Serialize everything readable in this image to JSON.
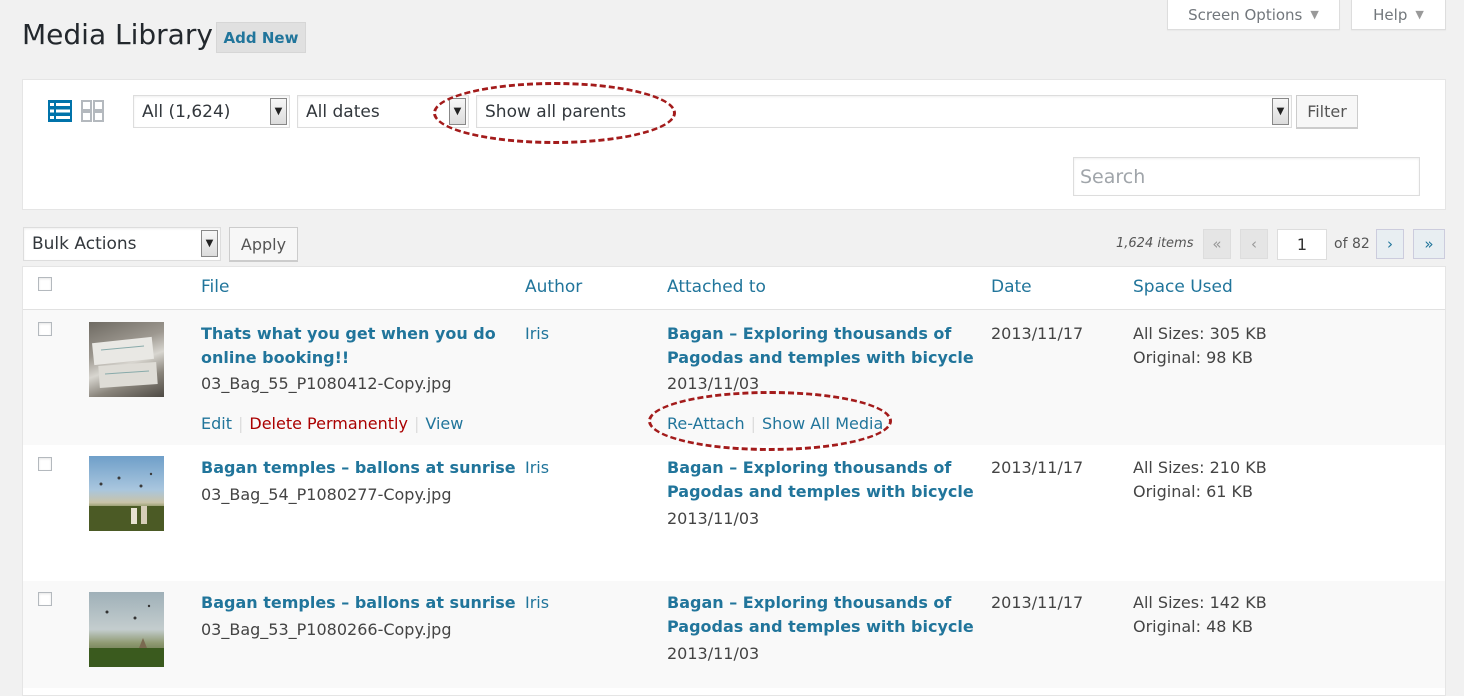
{
  "header": {
    "title": "Media Library",
    "add_new": "Add New",
    "screen_options": "Screen Options",
    "help": "Help"
  },
  "filters": {
    "type_select": "All (1,624)",
    "date_select": "All dates",
    "parent_select": "Show all parents",
    "filter_button": "Filter",
    "search_placeholder": "Search"
  },
  "bulk": {
    "select": "Bulk Actions",
    "apply": "Apply"
  },
  "pagination": {
    "items": "1,624 items",
    "first": "«",
    "prev": "‹",
    "current": "1",
    "of_total": "of 82",
    "next": "›",
    "last": "»"
  },
  "columns": {
    "file": "File",
    "author": "Author",
    "attached_to": "Attached to",
    "date": "Date",
    "space_used": "Space Used"
  },
  "rows": [
    {
      "title_line1": "Thats what you get when you do",
      "title_line2": "online booking!!",
      "filename": "03_Bag_55_P1080412-Copy.jpg",
      "author": "Iris",
      "attached_line1": "Bagan – Exploring thousands of",
      "attached_line2": "Pagodas and temples with bicycle",
      "attached_date": "2013/11/03",
      "date": "2013/11/17",
      "all_sizes": "All Sizes: 305 KB",
      "original": "Original: 98 KB",
      "actions": {
        "edit": "Edit",
        "delete": "Delete Permanently",
        "view": "View",
        "reattach": "Re-Attach",
        "show_all_media": "Show All Media"
      }
    },
    {
      "title_line1": "Bagan temples – ballons at sunrise",
      "filename": "03_Bag_54_P1080277-Copy.jpg",
      "author": "Iris",
      "attached_line1": "Bagan – Exploring thousands of",
      "attached_line2": "Pagodas and temples with bicycle",
      "attached_date": "2013/11/03",
      "date": "2013/11/17",
      "all_sizes": "All Sizes: 210 KB",
      "original": "Original: 61 KB"
    },
    {
      "title_line1": "Bagan temples – ballons at sunrise",
      "filename": "03_Bag_53_P1080266-Copy.jpg",
      "author": "Iris",
      "attached_line1": "Bagan – Exploring thousands of",
      "attached_line2": "Pagodas and temples with bicycle",
      "attached_date": "2013/11/03",
      "date": "2013/11/17",
      "all_sizes": "All Sizes: 142 KB",
      "original": "Original: 48 KB"
    }
  ],
  "icons": {
    "list_view": "list-view-icon",
    "grid_view": "grid-view-icon",
    "dropdown": "chevron-down-icon"
  },
  "colors": {
    "link": "#21759b",
    "delete": "#aa0000",
    "annotation": "#a31b1b",
    "background": "#f1f1f1"
  }
}
